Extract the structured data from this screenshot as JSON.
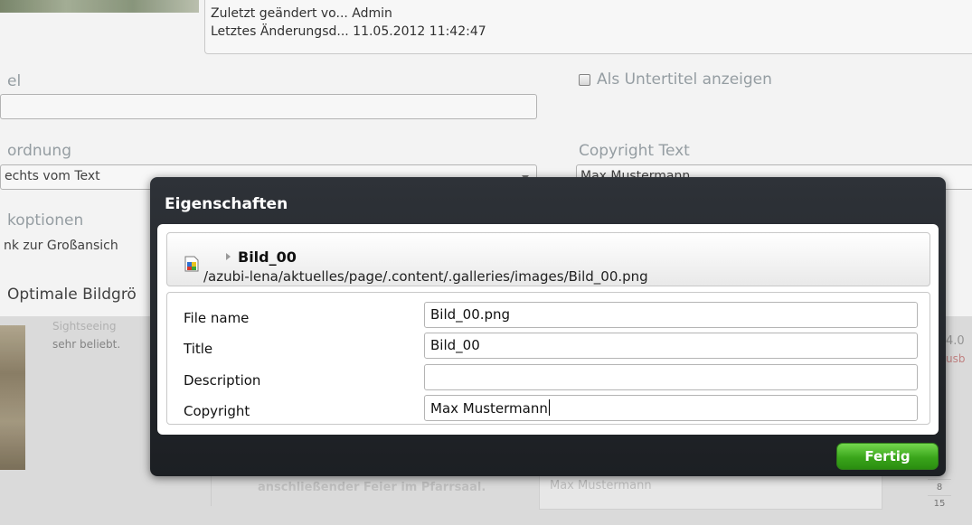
{
  "background_form": {
    "modified_by": "Zuletzt geändert vo... Admin",
    "modified_date": "Letztes Änderungsd... 11.05.2012 11:42:47",
    "title_label": "el",
    "title_value": "",
    "subtitle_checkbox_label": "Als Untertitel anzeigen",
    "arrangement_label": "ordnung",
    "arrangement_value": "echts vom Text",
    "copyright_label": "Copyright Text",
    "copyright_value": "Max Mustermann",
    "link_options_label": "koptionen",
    "link_options_value": "nk zur Großansich",
    "optimal_size_label": "Optimale Bildgrö"
  },
  "background_content": {
    "sightseeing_text": "Sightseeing",
    "popular_text": "sehr beliebt.",
    "celebration_text": "anschließender Feier im Pfarrsaal.",
    "author_text": "Max Mustermann",
    "calendar_numbers": [
      "8",
      "15"
    ],
    "right_number": "4.0",
    "right_red_text": "usb"
  },
  "dialog": {
    "title": "Eigenschaften",
    "resource_name": "Bild_00",
    "resource_path": "/azubi-lena/aktuelles/page/.content/.galleries/images/Bild_00.png",
    "properties": [
      {
        "label": "File name",
        "value": "Bild_00.png"
      },
      {
        "label": "Title",
        "value": "Bild_00"
      },
      {
        "label": "Description",
        "value": ""
      },
      {
        "label": "Copyright",
        "value": "Max Mustermann"
      }
    ],
    "done_button": "Fertig"
  },
  "colors": {
    "dialog_bg": "#2e3238",
    "done_button": "#3aa51b",
    "label_gray": "#9aa3a8"
  },
  "icons": {
    "resource_icon": "image-file-icon",
    "expand_icon": "triangle-right-icon",
    "select_icon": "chevron-down-icon"
  }
}
